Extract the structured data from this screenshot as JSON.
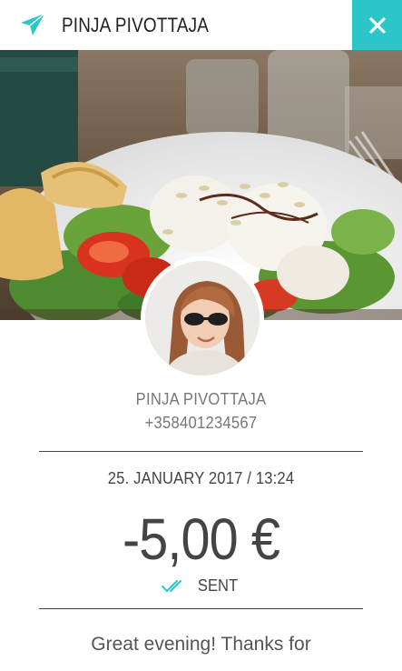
{
  "header": {
    "title": "PINJA PIVOTTAJA",
    "accent_color": "#2cc5c8",
    "left_icon": "send-icon",
    "close_icon": "close-icon"
  },
  "hero": {
    "image": "food-salad-photo"
  },
  "contact": {
    "avatar": "profile-photo",
    "name": "PINJA PIVOTTAJA",
    "phone": "+358401234567"
  },
  "transaction": {
    "date": "25. JANUARY 2017 / 13:24",
    "amount": "-5,00 €",
    "status_icon": "double-check-icon",
    "status": "SENT"
  },
  "message": "Great evening! Thanks for"
}
